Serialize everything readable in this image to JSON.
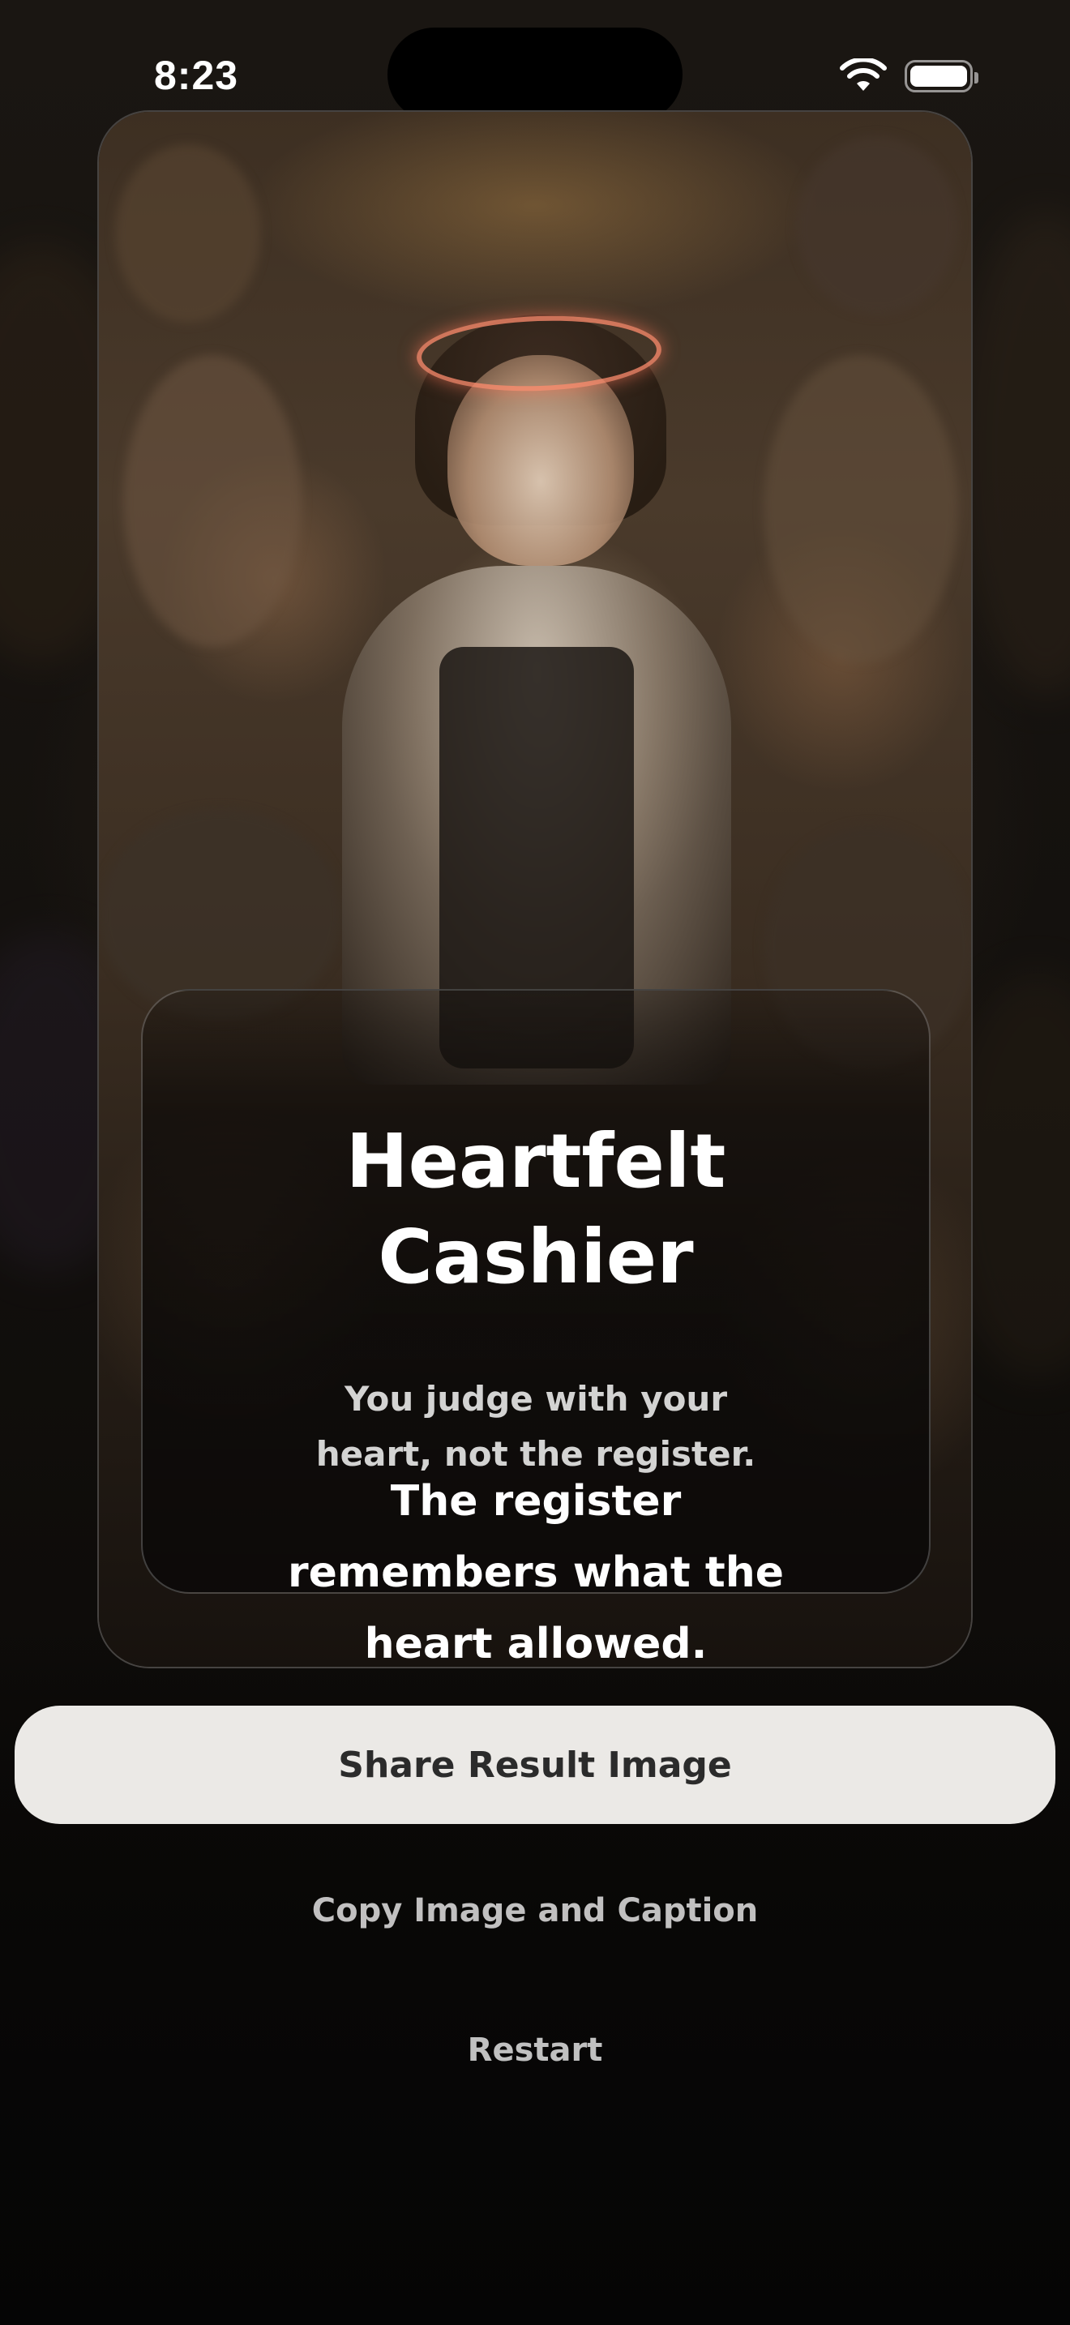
{
  "status_bar": {
    "time": "8:23"
  },
  "result": {
    "title": "Heartfelt Cashier",
    "subtitle": "You judge with your heart, not the register.",
    "tagline": "The register remembers what the heart allowed."
  },
  "actions": {
    "share_label": "Share Result Image",
    "copy_label": "Copy Image and Caption",
    "restart_label": "Restart"
  },
  "colors": {
    "primary_button_bg": "#ebe9e6",
    "primary_button_text": "#2b2b2b",
    "halo": "#ff8c6e",
    "background": "#0a0908"
  },
  "icons": [
    "wifi-icon",
    "battery-icon"
  ]
}
